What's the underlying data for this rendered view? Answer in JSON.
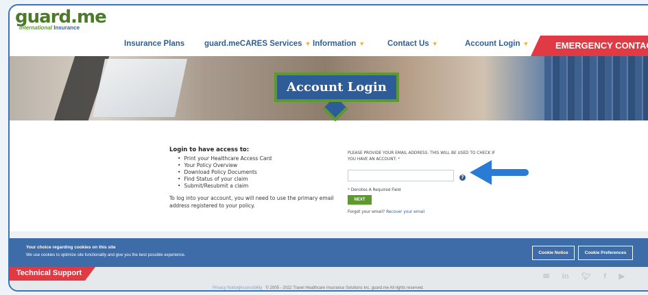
{
  "brand": {
    "logo_text": "guard.me",
    "tagline_intl": "International",
    "tagline": "Insurance"
  },
  "nav": {
    "items": [
      {
        "label": "Insurance Plans",
        "dropdown": false
      },
      {
        "label": "guard.meCARES Services",
        "dropdown": true
      },
      {
        "label": "Information",
        "dropdown": true
      },
      {
        "label": "Contact Us",
        "dropdown": true
      },
      {
        "label": "Account Login",
        "dropdown": true
      }
    ],
    "emergency": "EMERGENCY CONTACT"
  },
  "hero": {
    "title": "Account Login"
  },
  "login_info": {
    "heading": "Login to have access to:",
    "items": [
      "Print your Healthcare Access Card",
      "Your Policy Overview",
      "Download Policy Documents",
      "Find Status of your claim",
      "Submit/Resubmit a claim"
    ],
    "note": "To log into your account, you will need to use the primary email address registered to your policy."
  },
  "form": {
    "prompt": "PLEASE PROVIDE YOUR EMAIL ADDRESS. THIS WILL BE USED TO CHECK IF YOU HAVE AN ACCOUNT:",
    "required_mark": "*",
    "email_value": "",
    "help_icon": "question-circle-icon",
    "required_note": "Denotes A Required Field",
    "next_label": "NEXT",
    "forgot_text": "Forgot your email?",
    "recover_link": "Recover your email"
  },
  "cookie_bar": {
    "title": "Your choice regarding cookies on this site",
    "text": "We use cookies to optimize site functionality and give you the best possible experience.",
    "notice_button": "Cookie Notice",
    "preferences_button": "Cookie Preferences"
  },
  "footer": {
    "support": "Technical Support",
    "privacy": "Privacy Notice",
    "separator": "|",
    "accessibility": "Accessibility",
    "copyright": "© 2005 - 2022 Travel Healthcare Insurance Solutions Inc. guard.me All rights reserved.",
    "social_icons": [
      "email-icon",
      "linkedin-icon",
      "twitter-icon",
      "facebook-icon",
      "youtube-icon"
    ]
  },
  "colors": {
    "primary_blue": "#2e5c99",
    "green": "#5c9a2e",
    "red": "#e03a44",
    "annotation_arrow": "#2a7bd6"
  }
}
